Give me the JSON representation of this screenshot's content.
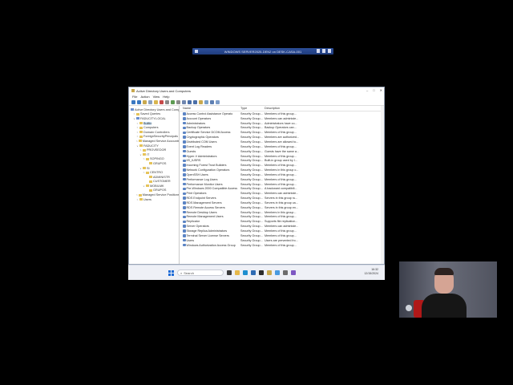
{
  "rdp_bar": {
    "title": "WINDOWS SERVER2025-DEN2 on DESK-CASA-001"
  },
  "window": {
    "title": "Active Directory Users and Computers",
    "controls": {
      "minimize": "–",
      "maximize": "□",
      "close": "✕"
    },
    "menu": [
      "File",
      "Action",
      "View",
      "Help"
    ]
  },
  "tree": [
    {
      "label": "Active Directory Users and Computers",
      "toggle": "",
      "indent": 0,
      "icon": "aduc-icon"
    },
    {
      "label": "Saved Queries",
      "toggle": ">",
      "indent": 1,
      "icon": "folder-icon"
    },
    {
      "label": "FADUCITY.LOCAL",
      "toggle": "v",
      "indent": 1,
      "icon": "domain-icon"
    },
    {
      "label": "Builtin",
      "toggle": ">",
      "indent": 2,
      "icon": "folder-icon",
      "selected": true
    },
    {
      "label": "Computers",
      "toggle": ">",
      "indent": 2,
      "icon": "folder-icon"
    },
    {
      "label": "Domain Controllers",
      "toggle": ">",
      "indent": 2,
      "icon": "folder-icon"
    },
    {
      "label": "ForeignSecurityPrincipals",
      "toggle": ">",
      "indent": 2,
      "icon": "folder-icon"
    },
    {
      "label": "Managed Service Accounts",
      "toggle": ">",
      "indent": 2,
      "icon": "folder-icon"
    },
    {
      "label": "FADUCITY",
      "toggle": "v",
      "indent": 2,
      "icon": "folder-icon"
    },
    {
      "label": "PROVEEDOR",
      "toggle": ">",
      "indent": 3,
      "icon": "folder-icon"
    },
    {
      "label": "IT",
      "toggle": "v",
      "indent": 3,
      "icon": "folder-icon"
    },
    {
      "label": "SOPINGO",
      "toggle": ">",
      "indent": 4,
      "icon": "folder-icon"
    },
    {
      "label": "GRUPOS",
      "toggle": "",
      "indent": 5,
      "icon": "folder-icon"
    },
    {
      "label": "SI",
      "toggle": "v",
      "indent": 3,
      "icon": "folder-icon"
    },
    {
      "label": "CENTRO",
      "toggle": ">",
      "indent": 4,
      "icon": "folder-icon"
    },
    {
      "label": "ADMINISTR",
      "toggle": "",
      "indent": 5,
      "icon": "folder-icon"
    },
    {
      "label": "CUSTOMER",
      "toggle": "",
      "indent": 5,
      "icon": "folder-icon"
    },
    {
      "label": "MOBILMK",
      "toggle": "v",
      "indent": 4,
      "icon": "folder-icon"
    },
    {
      "label": "GRUPOS",
      "toggle": "",
      "indent": 5,
      "icon": "folder-icon"
    },
    {
      "label": "Managed Service Positions",
      "toggle": ">",
      "indent": 2,
      "icon": "folder-icon"
    },
    {
      "label": "Users",
      "toggle": ">",
      "indent": 2,
      "icon": "folder-icon"
    }
  ],
  "list": {
    "columns": {
      "name": "Name",
      "type": "Type",
      "description": "Description"
    },
    "rows": [
      {
        "name": "Access Control Assistance Operato",
        "type": "Security Group...",
        "description": "Members of this group..."
      },
      {
        "name": "Account Operators",
        "type": "Security Group...",
        "description": "Members can administe..."
      },
      {
        "name": "Administrators",
        "type": "Security Group...",
        "description": "Administrators have co..."
      },
      {
        "name": "Backup Operators",
        "type": "Security Group...",
        "description": "Backup Operators can..."
      },
      {
        "name": "Certificate Service DCOM Access",
        "type": "Security Group...",
        "description": "Members of this group..."
      },
      {
        "name": "Cryptographic Operators",
        "type": "Security Group...",
        "description": "Members are authorized..."
      },
      {
        "name": "Distributed COM Users",
        "type": "Security Group...",
        "description": "Members are allowed to..."
      },
      {
        "name": "Event Log Readers",
        "type": "Security Group...",
        "description": "Members of this group..."
      },
      {
        "name": "Guests",
        "type": "Security Group...",
        "description": "Guests have the same a..."
      },
      {
        "name": "Hyper-V Administrators",
        "type": "Security Group...",
        "description": "Members of this group..."
      },
      {
        "name": "IIS_IUSRS",
        "type": "Security Group...",
        "description": "Built-in group used by I..."
      },
      {
        "name": "Incoming Forest Trust Builders",
        "type": "Security Group...",
        "description": "Members of this group..."
      },
      {
        "name": "Network Configuration Operators",
        "type": "Security Group...",
        "description": "Members in this group c..."
      },
      {
        "name": "OpenSSH Users",
        "type": "Security Group...",
        "description": "Members of this group..."
      },
      {
        "name": "Performance Log Users",
        "type": "Security Group...",
        "description": "Members of this group..."
      },
      {
        "name": "Performance Monitor Users",
        "type": "Security Group...",
        "description": "Members of this group..."
      },
      {
        "name": "Pre-Windows 2000 Compatible Access",
        "type": "Security Group...",
        "description": "A backward compatibili..."
      },
      {
        "name": "Print Operators",
        "type": "Security Group...",
        "description": "Members can administe..."
      },
      {
        "name": "RDS Endpoint Servers",
        "type": "Security Group...",
        "description": "Servers in this group ru..."
      },
      {
        "name": "RDS Management Servers",
        "type": "Security Group...",
        "description": "Servers in this group ca..."
      },
      {
        "name": "RDS Remote Access Servers",
        "type": "Security Group...",
        "description": "Servers in this group en..."
      },
      {
        "name": "Remote Desktop Users",
        "type": "Security Group...",
        "description": "Members in this group..."
      },
      {
        "name": "Remote Management Users",
        "type": "Security Group...",
        "description": "Members of this group..."
      },
      {
        "name": "Replicator",
        "type": "Security Group...",
        "description": "Supports file replication..."
      },
      {
        "name": "Server Operators",
        "type": "Security Group...",
        "description": "Members can administe..."
      },
      {
        "name": "Storage Replica Administrators",
        "type": "Security Group...",
        "description": "Members of this group..."
      },
      {
        "name": "Terminal Server License Servers",
        "type": "Security Group...",
        "description": "Members of this group..."
      },
      {
        "name": "Users",
        "type": "Security Group...",
        "description": "Users are prevented fro..."
      },
      {
        "name": "Windows Authorization Access Group",
        "type": "Security Group...",
        "description": "Members of this group..."
      }
    ]
  },
  "taskbar": {
    "search_placeholder": "Search",
    "apps": [
      {
        "name": "task-view-icon",
        "color": "#3c3c3c"
      },
      {
        "name": "file-explorer-icon",
        "color": "#e6b84a"
      },
      {
        "name": "edge-icon",
        "color": "#1f8fd0"
      },
      {
        "name": "server-manager-icon",
        "color": "#2f6bb3"
      },
      {
        "name": "terminal-icon",
        "color": "#2c2c2c"
      },
      {
        "name": "aduc-taskbar-icon",
        "color": "#c9a94e"
      },
      {
        "name": "notepad-icon",
        "color": "#4a9be0"
      },
      {
        "name": "settings-icon",
        "color": "#6d6d6d"
      },
      {
        "name": "store-icon",
        "color": "#7d57c2"
      }
    ],
    "clock": {
      "time": "16:32",
      "date": "12/15/2024"
    }
  }
}
